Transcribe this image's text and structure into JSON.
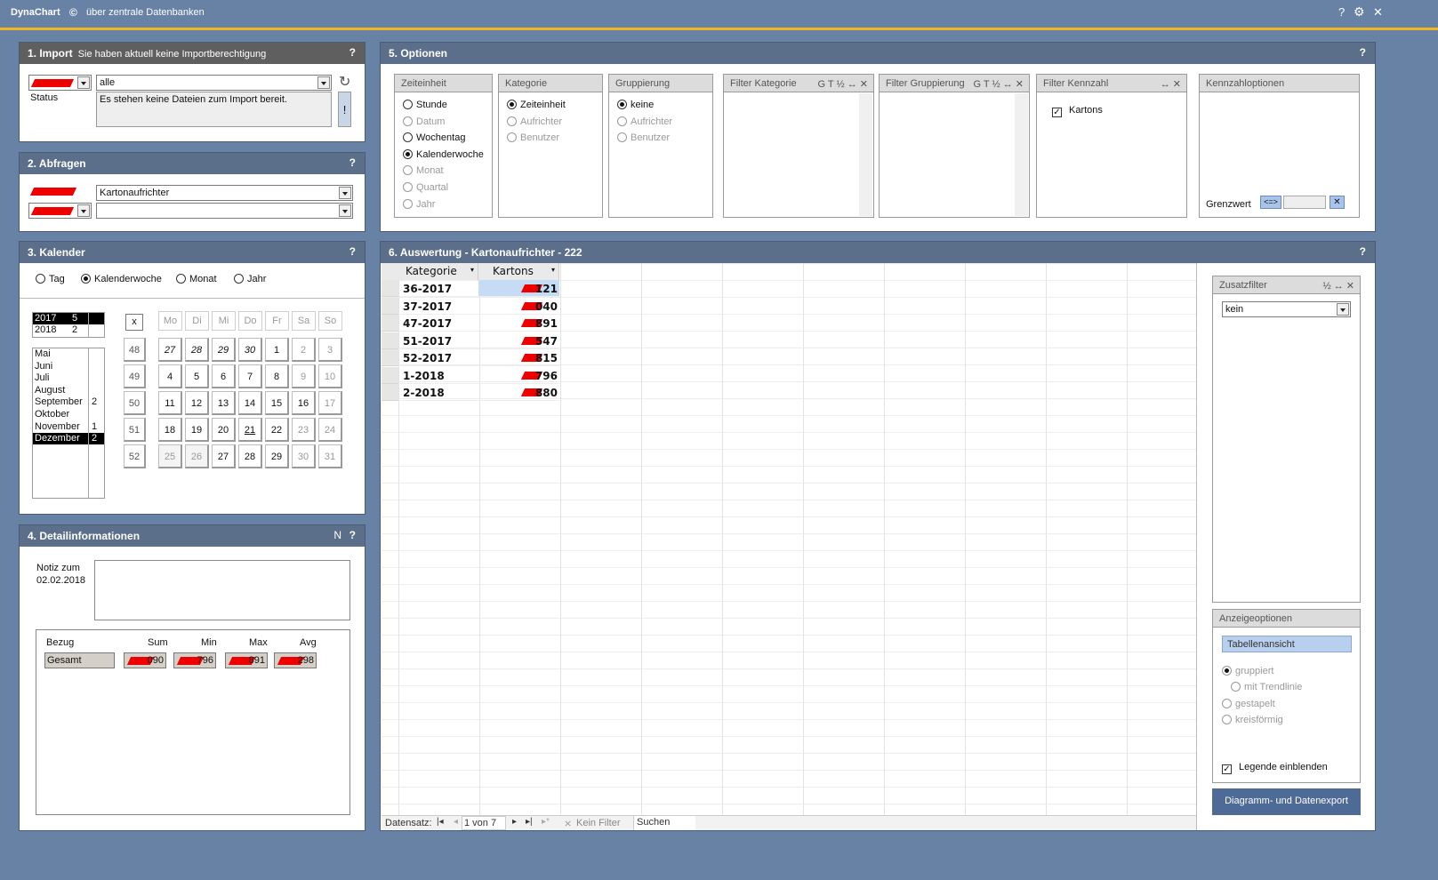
{
  "titlebar": {
    "app": "DynaChart",
    "copyright": "©",
    "subtitle": "über zentrale Datenbanken",
    "help": "?",
    "gear": "⚙",
    "close": "✕"
  },
  "import": {
    "title": "1. Import",
    "subtitle": "Sie haben aktuell keine Importberechtigung",
    "help": "?",
    "combo_value": "alle",
    "status_label": "Status",
    "status_text": "Es stehen keine Dateien zum Import bereit.",
    "refresh": "↻",
    "warn": "!"
  },
  "queries": {
    "title": "2. Abfragen",
    "help": "?",
    "combo1": "Kartonaufrichter",
    "combo2": ""
  },
  "calendar": {
    "title": "3. Kalender",
    "help": "?",
    "modes": [
      {
        "label": "Tag",
        "on": false
      },
      {
        "label": "Kalenderwoche",
        "on": true
      },
      {
        "label": "Monat",
        "on": false
      },
      {
        "label": "Jahr",
        "on": false
      }
    ],
    "years": [
      {
        "y": "2017",
        "n": "5",
        "sel": true
      },
      {
        "y": "2018",
        "n": "2",
        "sel": false
      }
    ],
    "months": [
      {
        "m": "Mai",
        "n": "",
        "sel": false
      },
      {
        "m": "Juni",
        "n": "",
        "sel": false
      },
      {
        "m": "Juli",
        "n": "",
        "sel": false
      },
      {
        "m": "August",
        "n": "",
        "sel": false
      },
      {
        "m": "September",
        "n": "2",
        "sel": false
      },
      {
        "m": "Oktober",
        "n": "",
        "sel": false
      },
      {
        "m": "November",
        "n": "1",
        "sel": false
      },
      {
        "m": "Dezember",
        "n": "2",
        "sel": true
      }
    ],
    "clear": "x",
    "weekdays": [
      "Mo",
      "Di",
      "Mi",
      "Do",
      "Fr",
      "Sa",
      "So"
    ],
    "weeks": [
      "48",
      "49",
      "50",
      "51",
      "52"
    ],
    "days": [
      [
        "27",
        "28",
        "29",
        "30",
        "1",
        "2",
        "3"
      ],
      [
        "4",
        "5",
        "6",
        "7",
        "8",
        "9",
        "10"
      ],
      [
        "11",
        "12",
        "13",
        "14",
        "15",
        "16",
        "17"
      ],
      [
        "18",
        "19",
        "20",
        "21",
        "22",
        "23",
        "24"
      ],
      [
        "25",
        "26",
        "27",
        "28",
        "29",
        "30",
        "31"
      ]
    ]
  },
  "details": {
    "title": "4. Detailinformationen",
    "n": "N",
    "help": "?",
    "note_label_1": "Notiz zum",
    "note_label_2": "02.02.2018",
    "cols": [
      "Bezug",
      "Sum",
      "Min",
      "Max",
      "Avg"
    ],
    "row_label": "Gesamt",
    "row_values": [
      "090",
      "796",
      "891",
      "298"
    ]
  },
  "options": {
    "title": "5. Optionen",
    "help": "?",
    "zeiteinheit": {
      "title": "Zeiteinheit",
      "items": [
        {
          "label": "Stunde",
          "on": false,
          "dis": false
        },
        {
          "label": "Datum",
          "on": false,
          "dis": true
        },
        {
          "label": "Wochentag",
          "on": false,
          "dis": false
        },
        {
          "label": "Kalenderwoche",
          "on": true,
          "dis": false
        },
        {
          "label": "Monat",
          "on": false,
          "dis": true
        },
        {
          "label": "Quartal",
          "on": false,
          "dis": true
        },
        {
          "label": "Jahr",
          "on": false,
          "dis": true
        }
      ]
    },
    "kategorie": {
      "title": "Kategorie",
      "items": [
        {
          "label": "Zeiteinheit",
          "on": true,
          "dis": false
        },
        {
          "label": "Aufrichter",
          "on": false,
          "dis": true
        },
        {
          "label": "Benutzer",
          "on": false,
          "dis": true
        }
      ]
    },
    "gruppierung": {
      "title": "Gruppierung",
      "items": [
        {
          "label": "keine",
          "on": true,
          "dis": false
        },
        {
          "label": "Aufrichter",
          "on": false,
          "dis": true
        },
        {
          "label": "Benutzer",
          "on": false,
          "dis": true
        }
      ]
    },
    "filter_kategorie": {
      "title": "Filter Kategorie",
      "icons": "G T ½ ↔ ✕"
    },
    "filter_gruppierung": {
      "title": "Filter Gruppierung",
      "icons": "G T ½ ↔ ✕"
    },
    "filter_kennzahl": {
      "title": "Filter Kennzahl",
      "icons": "↔ ✕",
      "item": "Kartons",
      "checkmark": "✓"
    },
    "kennzahloptionen": {
      "title": "Kennzahloptionen",
      "grenzwert": "Grenzwert",
      "op": "<=>",
      "x": "✕"
    }
  },
  "auswertung": {
    "title": "6. Auswertung - Kartonaufrichter - 222",
    "help": "?",
    "columns": [
      "Kategorie",
      "Kartons"
    ],
    "rows": [
      {
        "k": "36-2017",
        "v": "121"
      },
      {
        "k": "37-2017",
        "v": "040"
      },
      {
        "k": "47-2017",
        "v": "891"
      },
      {
        "k": "51-2017",
        "v": "547"
      },
      {
        "k": "52-2017",
        "v": "815"
      },
      {
        "k": "1-2018",
        "v": "796"
      },
      {
        "k": "2-2018",
        "v": "880"
      }
    ],
    "nav": {
      "label": "Datensatz:",
      "first": "|◂",
      "prev": "◂",
      "pos": "1 von 7",
      "next": "▸",
      "last": "▸|",
      "new": "▸*",
      "filter": "Kein Filter",
      "search": "Suchen"
    }
  },
  "zusatzfilter": {
    "title": "Zusatzfilter",
    "icons": "½ ↔ ✕",
    "value": "kein"
  },
  "anzeige": {
    "title": "Anzeigeoptionen",
    "button": "Tabellenansicht",
    "opts": [
      {
        "label": "gruppiert",
        "on": true
      },
      {
        "label": "mit Trendlinie",
        "on": false
      },
      {
        "label": "gestapelt",
        "on": false
      },
      {
        "label": "kreisförmig",
        "on": false
      }
    ],
    "legend": "Legende einblenden",
    "legend_check": "✓"
  },
  "export": {
    "label": "Diagramm- und Datenexport"
  }
}
